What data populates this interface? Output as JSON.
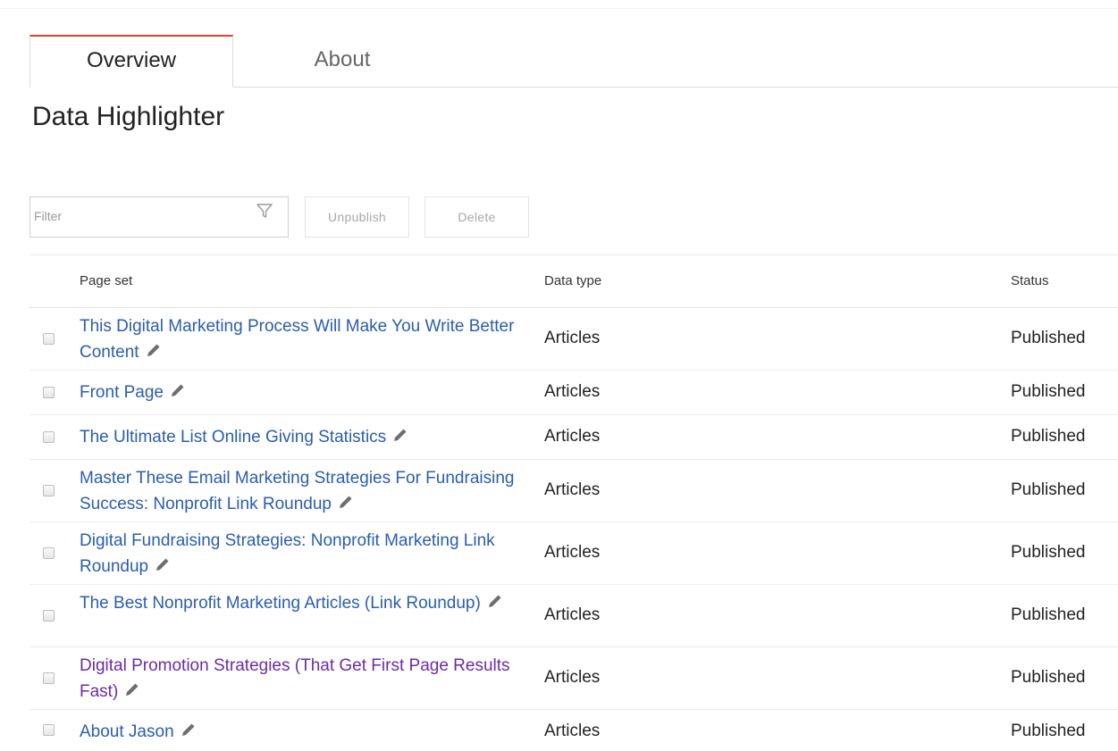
{
  "tabs": {
    "overview": "Overview",
    "about": "About"
  },
  "page": {
    "title": "Data Highlighter"
  },
  "toolbar": {
    "filter_placeholder": "Filter",
    "filter_value": "",
    "unpublish_label": "Unpublish",
    "delete_label": "Delete"
  },
  "table": {
    "headers": {
      "page_set": "Page set",
      "data_type": "Data type",
      "status": "Status"
    },
    "rows": [
      {
        "page_set": "This Digital Marketing Process Will Make You Write Better Content",
        "data_type": "Articles",
        "status": "Published"
      },
      {
        "page_set": "Front Page",
        "data_type": "Articles",
        "status": "Published"
      },
      {
        "page_set": "The Ultimate List Online Giving Statistics",
        "data_type": "Articles",
        "status": "Published"
      },
      {
        "page_set": "Master These Email Marketing Strategies For Fundraising Success: Nonprofit Link Roundup",
        "data_type": "Articles",
        "status": "Published"
      },
      {
        "page_set": "Digital Fundraising Strategies: Nonprofit Marketing Link Roundup",
        "data_type": "Articles",
        "status": "Published"
      },
      {
        "page_set": "The Best Nonprofit Marketing Articles (Link Roundup)",
        "data_type": "Articles",
        "status": "Published"
      },
      {
        "page_set": "Digital Promotion Strategies (That Get First Page Results Fast)",
        "data_type": "Articles",
        "status": "Published"
      },
      {
        "page_set": "About Jason",
        "data_type": "Articles",
        "status": "Published"
      }
    ]
  },
  "colors": {
    "active_tab_accent": "#d9442f",
    "link": "#2a5db0",
    "visited_link": "#6b2ba8"
  },
  "icons": {
    "filter": "filter-funnel-icon",
    "edit": "pencil-icon"
  }
}
